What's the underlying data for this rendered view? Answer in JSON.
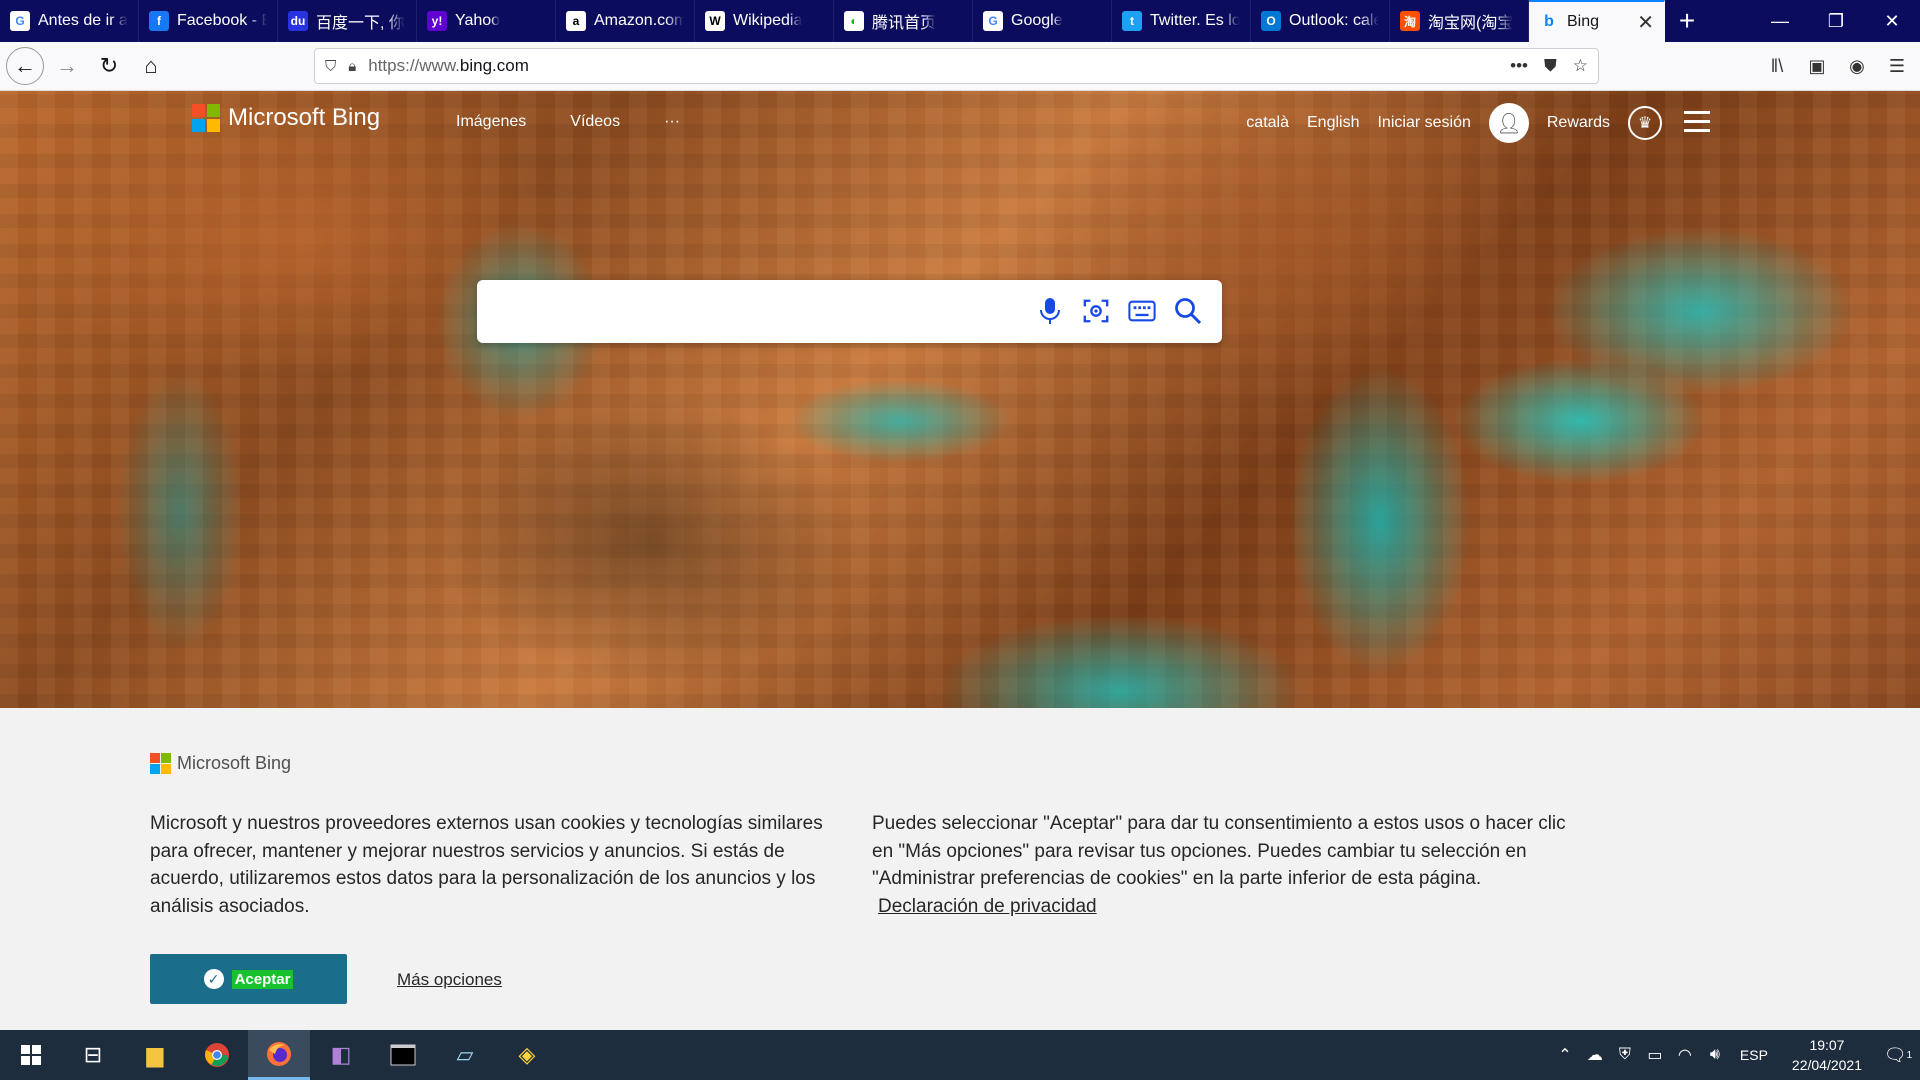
{
  "tabs": [
    {
      "title": "Antes de ir a",
      "favicon": "G",
      "favicon_bg": "#ffffff",
      "favicon_color": "#4285f4"
    },
    {
      "title": "Facebook - E",
      "favicon": "f",
      "favicon_bg": "#1877f2",
      "favicon_color": "#ffffff"
    },
    {
      "title": "百度一下, 你",
      "favicon": "du",
      "favicon_bg": "#2932e1",
      "favicon_color": "#ffffff"
    },
    {
      "title": "Yahoo",
      "favicon": "y!",
      "favicon_bg": "#6001d2",
      "favicon_color": "#ffffff"
    },
    {
      "title": "Amazon.com",
      "favicon": "a",
      "favicon_bg": "#ffffff",
      "favicon_color": "#000000"
    },
    {
      "title": "Wikipedia",
      "favicon": "W",
      "favicon_bg": "#ffffff",
      "favicon_color": "#000000"
    },
    {
      "title": "腾讯首页",
      "favicon": "◐",
      "favicon_bg": "#ffffff",
      "favicon_color": "#1aad19"
    },
    {
      "title": "Google",
      "favicon": "G",
      "favicon_bg": "#ffffff",
      "favicon_color": "#4285f4"
    },
    {
      "title": "Twitter. Es lo",
      "favicon": "t",
      "favicon_bg": "#1da1f2",
      "favicon_color": "#ffffff"
    },
    {
      "title": "Outlook: cale",
      "favicon": "O",
      "favicon_bg": "#0078d4",
      "favicon_color": "#ffffff"
    },
    {
      "title": "淘宝网(淘宝",
      "favicon": "淘",
      "favicon_bg": "#ff5000",
      "favicon_color": "#ffffff"
    }
  ],
  "active_tab": {
    "title": "Bing",
    "favicon": "b",
    "close": "✕"
  },
  "window": {
    "minimize": "—",
    "restore": "❐",
    "close": "✕",
    "new_tab": "+"
  },
  "nav": {
    "url_prefix": "https://www.",
    "url_domain": "bing.com",
    "more_icon": "•••",
    "pocket_icon": "pocket-icon",
    "bookmark_icon": "star-icon"
  },
  "bing": {
    "brand": "Microsoft Bing",
    "nav_images": "Imágenes",
    "nav_videos": "Vídeos",
    "nav_more": "···",
    "lang_ca": "català",
    "lang_en": "English",
    "signin": "Iniciar sesión",
    "rewards": "Rewards",
    "search_value": ""
  },
  "cookie": {
    "brand": "Microsoft Bing",
    "text1": "Microsoft y nuestros proveedores externos usan cookies y tecnologías similares para ofrecer, mantener y mejorar nuestros servicios y anuncios. Si estás de acuerdo, utilizaremos estos datos para la personalización de los anuncios y los análisis asociados.",
    "text2": "Puedes seleccionar \"Aceptar\" para dar tu consentimiento a estos usos o hacer clic en \"Más opciones\" para revisar tus opciones. Puedes cambiar tu selección en \"Administrar preferencias de cookies\" en la parte inferior de esta página.",
    "privacy_link": "Declaración de privacidad",
    "accept": "Aceptar",
    "more_options": "Más opciones"
  },
  "taskbar": {
    "lang": "ESP",
    "time": "19:07",
    "date": "22/04/2021",
    "notif_count": "1"
  },
  "colors": {
    "tab_strip": "#0c0c5e",
    "accept_button": "#1b6d8c",
    "taskbar": "#1e2d3e"
  }
}
